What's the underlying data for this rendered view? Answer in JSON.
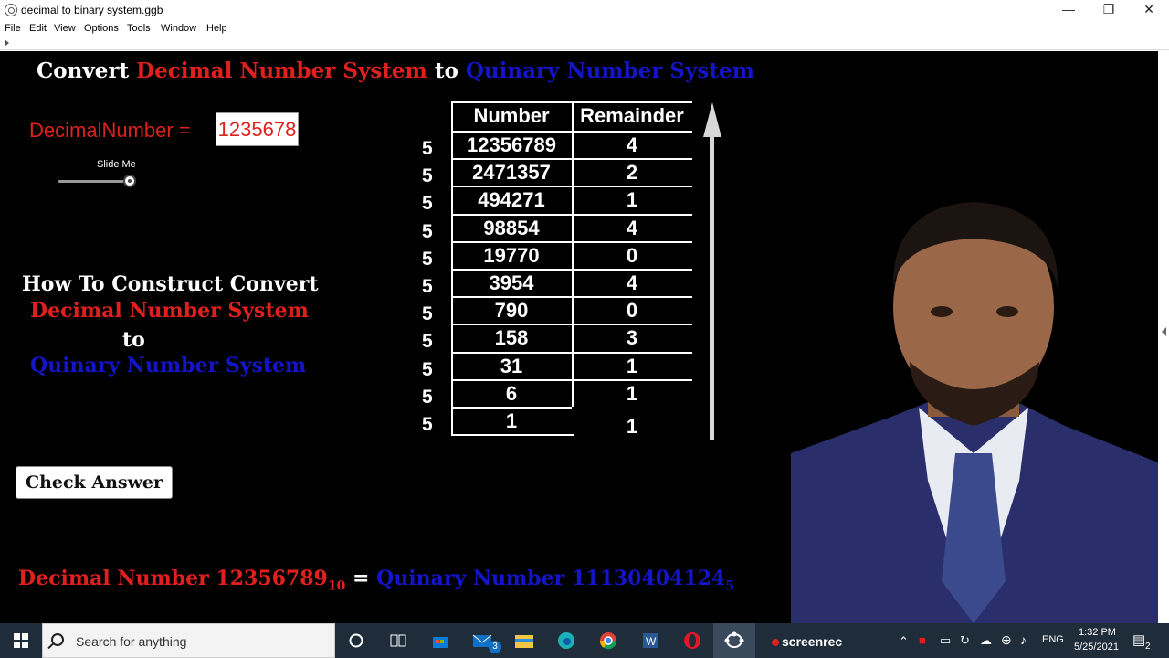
{
  "window": {
    "title": "decimal to binary system.ggb",
    "minimize": "—",
    "maximize": "❐",
    "close": "✕"
  },
  "menu": [
    "File",
    "Edit",
    "View",
    "Options",
    "Tools",
    "Window",
    "Help"
  ],
  "heading": {
    "part1": "Convert ",
    "part2": "Decimal Number System",
    "part3": " to ",
    "part4": "Quinary Number System"
  },
  "decimal_input": {
    "label": "DecimalNumber = ",
    "value": "1235678"
  },
  "slider": {
    "label": "Slide Me",
    "level": 1.0
  },
  "howto": {
    "line1": "How To Construct Convert",
    "line2": "Decimal Number System",
    "line3": "to",
    "line4": "Quinary Number System"
  },
  "check_button": "Check Answer",
  "table": {
    "header_number": "Number",
    "header_remainder": "Remainder",
    "divisor": "5",
    "rows": [
      {
        "number": "12356789",
        "remainder": "4"
      },
      {
        "number": "2471357",
        "remainder": "2"
      },
      {
        "number": "494271",
        "remainder": "1"
      },
      {
        "number": "98854",
        "remainder": "4"
      },
      {
        "number": "19770",
        "remainder": "0"
      },
      {
        "number": "3954",
        "remainder": "4"
      },
      {
        "number": "790",
        "remainder": "0"
      },
      {
        "number": "158",
        "remainder": "3"
      },
      {
        "number": "31",
        "remainder": "1"
      },
      {
        "number": "6",
        "remainder": "1"
      },
      {
        "number": "1",
        "remainder": "1"
      }
    ]
  },
  "result": {
    "decimal_label": "Decimal Number 12356789",
    "decimal_base": "10",
    "equals": " = ",
    "quinary_label": "Quinary Number 11130404124",
    "quinary_base": "5"
  },
  "taskbar": {
    "search_placeholder": "Search for anything",
    "mail_badge": "3",
    "screenrec": "screenrec",
    "language": "ENG",
    "time": "1:32 PM",
    "date": "5/25/2021",
    "notification_count": "2"
  },
  "colors": {
    "red": "#e0201e",
    "blue": "#1414c8",
    "canvas": "#000000"
  }
}
